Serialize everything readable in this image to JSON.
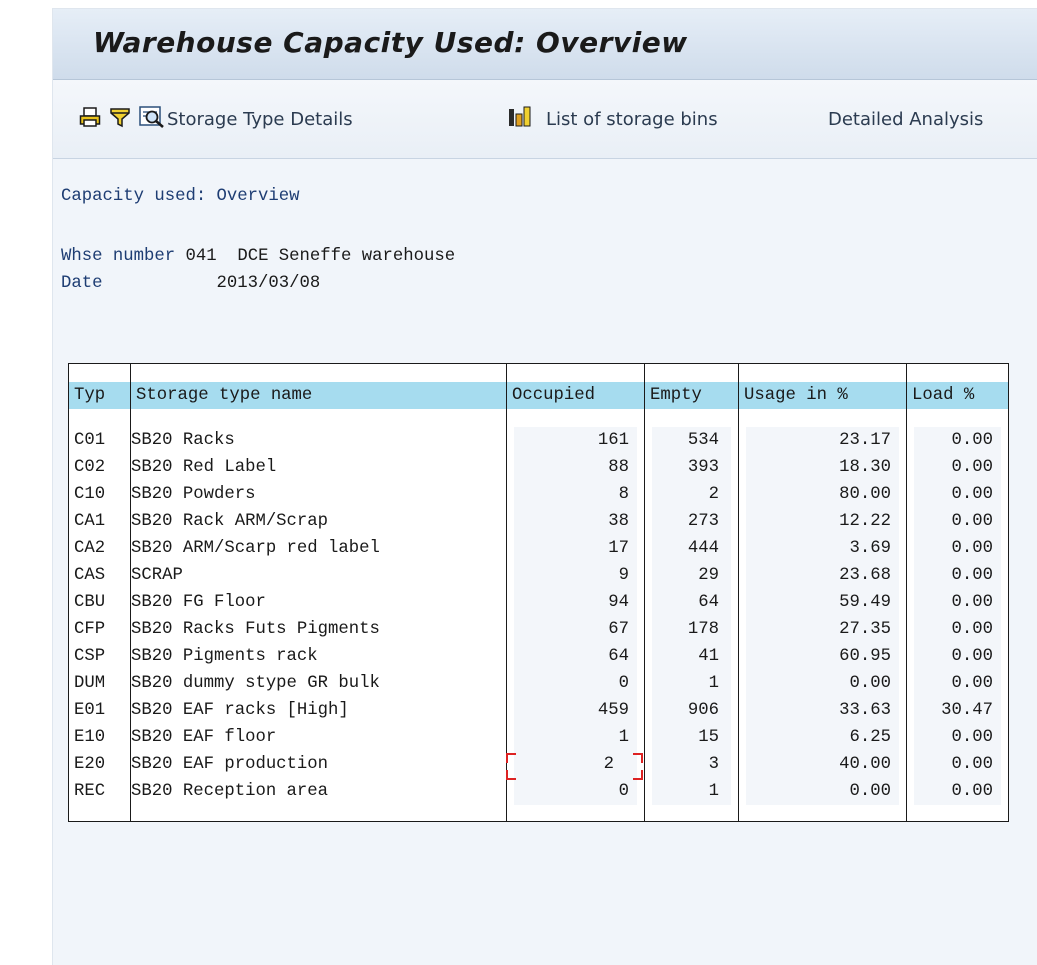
{
  "window": {
    "title": "Warehouse Capacity Used: Overview"
  },
  "toolbar": {
    "storage_type_details": "Storage Type Details",
    "list_of_storage_bins": "List of storage bins",
    "detailed_analysis": "Detailed Analysis",
    "icons": [
      "print-icon",
      "filter-icon",
      "details-icon",
      "chart-icon"
    ]
  },
  "report": {
    "heading": "Capacity used: Overview",
    "whse_label": "Whse number",
    "whse_number": "041",
    "whse_name": "DCE Seneffe warehouse",
    "date_label": "Date",
    "date": "2013/03/08"
  },
  "table": {
    "headers": [
      "Typ",
      "Storage type name",
      "Occupied",
      "Empty",
      "Usage in %",
      "Load %"
    ],
    "rows": [
      [
        "C01",
        "SB20 Racks",
        "161",
        "534",
        "23.17",
        "0.00"
      ],
      [
        "C02",
        "SB20 Red Label",
        "88",
        "393",
        "18.30",
        "0.00"
      ],
      [
        "C10",
        "SB20 Powders",
        "8",
        "2",
        "80.00",
        "0.00"
      ],
      [
        "CA1",
        "SB20 Rack ARM/Scrap",
        "38",
        "273",
        "12.22",
        "0.00"
      ],
      [
        "CA2",
        "SB20 ARM/Scarp red label",
        "17",
        "444",
        "3.69",
        "0.00"
      ],
      [
        "CAS",
        "SCRAP",
        "9",
        "29",
        "23.68",
        "0.00"
      ],
      [
        "CBU",
        "SB20 FG Floor",
        "94",
        "64",
        "59.49",
        "0.00"
      ],
      [
        "CFP",
        "SB20 Racks Futs Pigments",
        "67",
        "178",
        "27.35",
        "0.00"
      ],
      [
        "CSP",
        "SB20 Pigments rack",
        "64",
        "41",
        "60.95",
        "0.00"
      ],
      [
        "DUM",
        "SB20 dummy stype GR bulk",
        "0",
        "1",
        "0.00",
        "0.00"
      ],
      [
        "E01",
        "SB20 EAF racks [High]",
        "459",
        "906",
        "33.63",
        "30.47"
      ],
      [
        "E10",
        "SB20 EAF floor",
        "1",
        "15",
        "6.25",
        "0.00"
      ],
      [
        "E20",
        "SB20 EAF production",
        "2",
        "3",
        "40.00",
        "0.00"
      ],
      [
        "REC",
        "SB20 Reception area",
        "0",
        "1",
        "0.00",
        "0.00"
      ]
    ],
    "selected_cell": {
      "row": 12,
      "column": 2
    }
  },
  "colors": {
    "header_fill": "#a6dcef",
    "title_gradient_top": "#e6eef7",
    "label_text": "#1e3d73",
    "cursor_marker": "#dd2222"
  }
}
